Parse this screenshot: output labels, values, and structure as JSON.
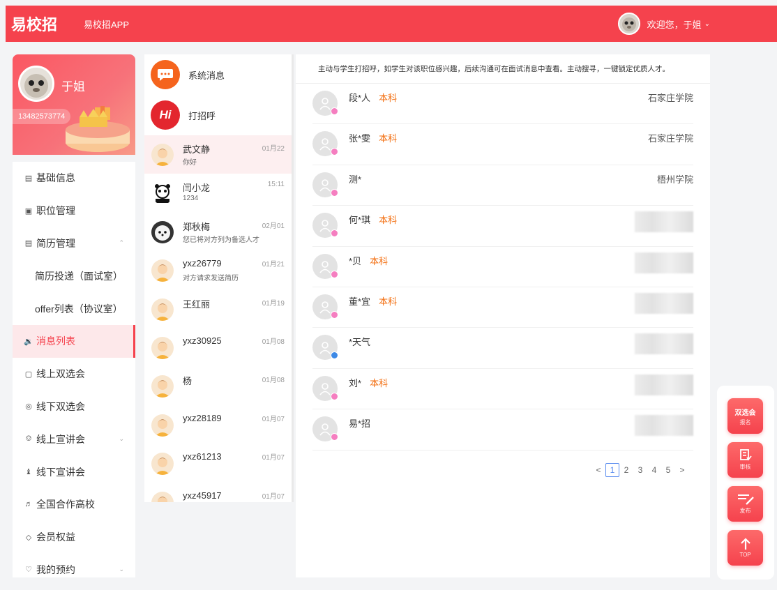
{
  "header": {
    "logo": "易校招",
    "app_link": "易校招APP",
    "welcome": "欢迎您，于姐"
  },
  "profile": {
    "name": "于姐",
    "phone": "13482573774"
  },
  "menu": [
    {
      "label": "基础信息",
      "icon": "document-icon"
    },
    {
      "label": "职位管理",
      "icon": "briefcase-icon"
    },
    {
      "label": "简历管理",
      "icon": "resume-icon"
    },
    {
      "label": "简历投递（面试室）"
    },
    {
      "label": "offer列表（协议室）"
    },
    {
      "label": "消息列表",
      "icon": "speaker-icon"
    },
    {
      "label": "线上双选会",
      "icon": "screen-icon"
    },
    {
      "label": "线下双选会",
      "icon": "location-icon"
    },
    {
      "label": "线上宣讲会",
      "icon": "microphone-icon"
    },
    {
      "label": "线下宣讲会",
      "icon": "people-icon"
    },
    {
      "label": "全国合作高校",
      "icon": "school-icon"
    },
    {
      "label": "会员权益",
      "icon": "diamond-icon"
    },
    {
      "label": "我的预约",
      "icon": "heart-icon"
    }
  ],
  "chat": {
    "system": "系统消息",
    "greet": "打招呼",
    "greet_icon_text": "Hi",
    "items": [
      {
        "name": "武文静",
        "msg": "你好",
        "time": "01月22"
      },
      {
        "name": "闫小龙",
        "msg": "1234",
        "time": "15:11"
      },
      {
        "name": "郑秋梅",
        "msg": "您已将对方列为备选人才",
        "time": "02月01"
      },
      {
        "name": "yxz26779",
        "msg": "对方请求发送简历",
        "time": "01月21"
      },
      {
        "name": "王红丽",
        "msg": "",
        "time": "01月19"
      },
      {
        "name": "yxz30925",
        "msg": "",
        "time": "01月08"
      },
      {
        "name": "杨",
        "msg": "",
        "time": "01月08"
      },
      {
        "name": "yxz28189",
        "msg": "",
        "time": "01月07"
      },
      {
        "name": "yxz61213",
        "msg": "",
        "time": "01月07"
      },
      {
        "name": "yxz45917",
        "msg": "",
        "time": "01月07"
      }
    ]
  },
  "main": {
    "notice": "主动与学生打招呼，如学生对该职位感兴趣，后续沟通可在面试消息中查看。主动搜寻，一键锁定优质人才。",
    "students": [
      {
        "name": "段*人",
        "edu": "本科",
        "school": "石家庄学院",
        "gender": "f"
      },
      {
        "name": "张*雯",
        "edu": "本科",
        "school": "石家庄学院",
        "gender": "f"
      },
      {
        "name": "测*",
        "edu": "",
        "school": "梧州学院",
        "gender": "f"
      },
      {
        "name": "何*琪",
        "edu": "本科",
        "school": "",
        "gender": "f"
      },
      {
        "name": "*贝",
        "edu": "本科",
        "school": "",
        "gender": "f"
      },
      {
        "name": "董*宜",
        "edu": "本科",
        "school": "",
        "gender": "f"
      },
      {
        "name": "*天气",
        "edu": "",
        "school": "",
        "gender": "m"
      },
      {
        "name": "刘*",
        "edu": "本科",
        "school": "",
        "gender": "f"
      },
      {
        "name": "易*招",
        "edu": "",
        "school": "",
        "gender": "f"
      }
    ],
    "pagination": {
      "prev": "<",
      "pages": [
        "1",
        "2",
        "3",
        "4",
        "5"
      ],
      "current": "1",
      "next": ">"
    }
  },
  "float_buttons": [
    {
      "t1": "双选会",
      "t2": "报名"
    },
    {
      "t1": "",
      "t2": "审核"
    },
    {
      "t1": "",
      "t2": "发布"
    },
    {
      "t1": "",
      "t2": "TOP"
    }
  ],
  "colors": {
    "brand": "#f5424d",
    "edu": "#f36d0e",
    "pager_active": "#5b8def"
  }
}
